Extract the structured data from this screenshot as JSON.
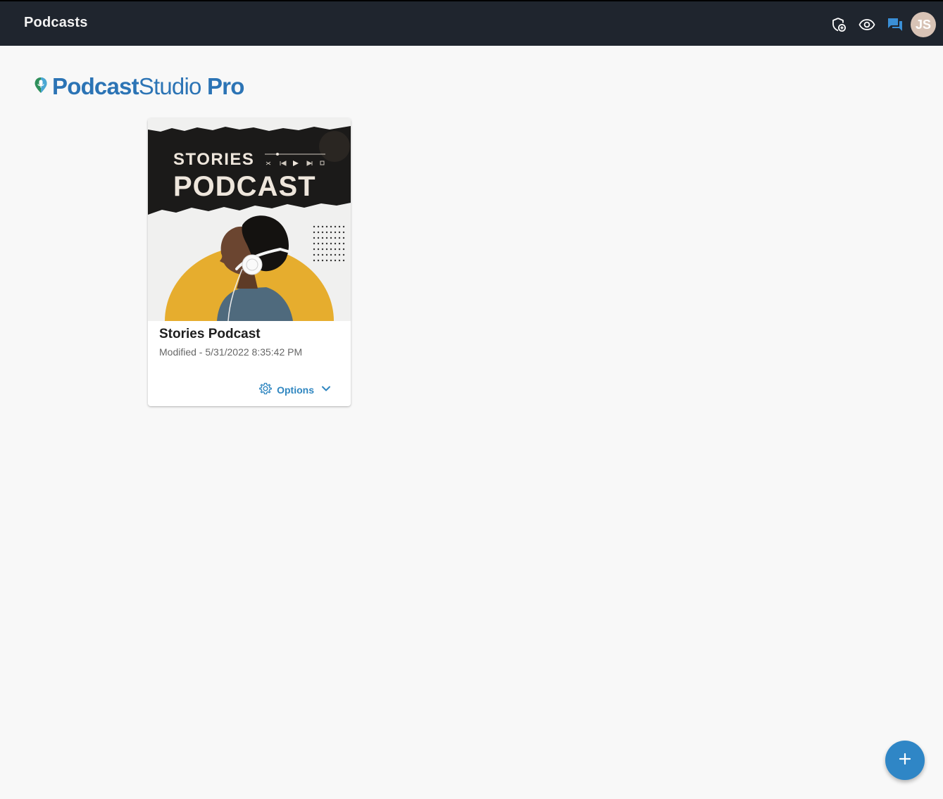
{
  "header": {
    "title": "Podcasts",
    "icons": [
      "shield-add-icon",
      "eye-icon",
      "chat-icon"
    ],
    "avatar_initials": "JS"
  },
  "brand": {
    "logo_part1": "Podcast",
    "logo_part2": "Studio",
    "logo_part3": "Pro",
    "color": "#2c74b5"
  },
  "podcasts": [
    {
      "cover": {
        "line1": "STORIES",
        "line2": "PODCAST"
      },
      "title": "Stories Podcast",
      "modified": "Modified - 5/31/2022 8:35:42 PM",
      "options_label": "Options"
    }
  ],
  "fab": {
    "icon": "plus-icon"
  },
  "colors": {
    "header_bg": "#1f252e",
    "accent": "#2f86c6",
    "cover_yellow": "#e6ad2e"
  }
}
